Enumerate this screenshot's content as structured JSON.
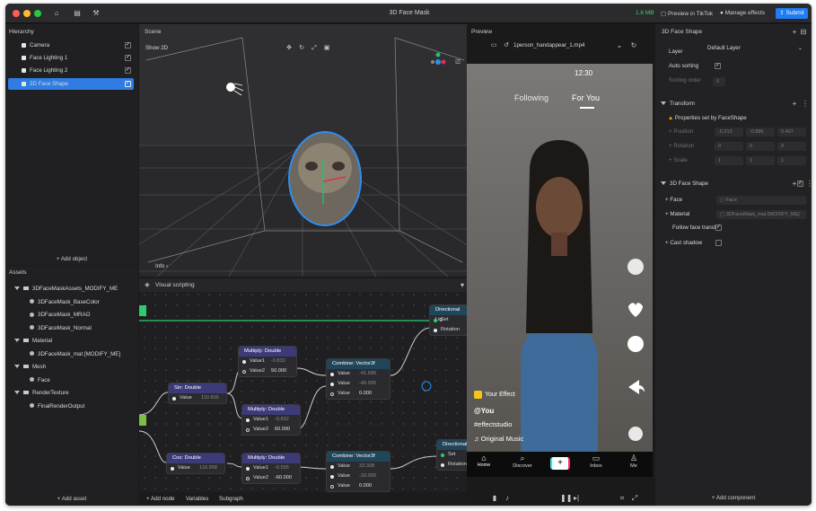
{
  "window": {
    "title": "3D Face Mask",
    "memory": "1.6 MB",
    "preview_in_tiktok": "Preview in TikTok",
    "manage_effects": "Manage effects",
    "submit": "Submit"
  },
  "hierarchy": {
    "title": "Hierarchy",
    "items": [
      {
        "label": "Camera"
      },
      {
        "label": "Face Lighting 1"
      },
      {
        "label": "Face Lighting 2"
      },
      {
        "label": "3D Face Shape"
      }
    ],
    "add_label": "+ Add object"
  },
  "assets": {
    "title": "Assets",
    "items": [
      {
        "label": "3DFaceMaskAssets_MODIFY_ME",
        "kind": "folder",
        "level": 0
      },
      {
        "label": "3DFaceMask_BaseColor",
        "kind": "file",
        "level": 1
      },
      {
        "label": "3DFaceMask_MRAO",
        "kind": "file",
        "level": 1
      },
      {
        "label": "3DFaceMask_Normal",
        "kind": "file",
        "level": 1
      },
      {
        "label": "Material",
        "kind": "folder",
        "level": 0
      },
      {
        "label": "3DFaceMask_mat [MODIFY_ME]",
        "kind": "file",
        "level": 1
      },
      {
        "label": "Mesh",
        "kind": "folder",
        "level": 0
      },
      {
        "label": "Face",
        "kind": "file",
        "level": 1
      },
      {
        "label": "RenderTexture",
        "kind": "folder",
        "level": 0
      },
      {
        "label": "FinalRenderOutput",
        "kind": "file",
        "level": 1
      }
    ],
    "add_label": "+ Add asset"
  },
  "scene": {
    "title": "Scene",
    "show2d": "Show 2D",
    "info": "Info"
  },
  "visual_scripting": {
    "title": "Visual scripting",
    "footer": {
      "add_node": "+ Add node",
      "variables": "Variables",
      "subgraph": "Subgraph"
    },
    "nodes": {
      "sin": {
        "title": "Sin: Double",
        "value_label": "Value",
        "value": "110.835"
      },
      "cos": {
        "title": "Cos: Double",
        "value_label": "Value",
        "value": "110.958"
      },
      "mul1": {
        "title": "Multiply: Double",
        "v1_label": "Value1",
        "v1": "-0.832",
        "v2_label": "Value2",
        "v2": "50.000"
      },
      "mul2": {
        "title": "Multiply: Double",
        "v1_label": "Value1",
        "v1": "-0.832",
        "v2_label": "Value2",
        "v2": "60.000"
      },
      "mul3": {
        "title": "Multiply: Double",
        "v1_label": "Value1",
        "v1": "-0.555",
        "v2_label": "Value2",
        "v2": "-60.000"
      },
      "comb1": {
        "title": "Combine: Vector3f",
        "r1_label": "Value",
        "r1": "-41.588",
        "r2_label": "Value",
        "r2": "-49.905",
        "r3_label": "Value",
        "r3": "0.000"
      },
      "comb2": {
        "title": "Combine: Vector3f",
        "r1_label": "Value",
        "r1": "33.308",
        "r2_label": "Value",
        "r2": "-33.000",
        "r3_label": "Value",
        "r3": "0.000"
      },
      "dir1": {
        "title": "Directional Lig",
        "set": "Set",
        "rotation": "Rotation"
      },
      "dir2": {
        "title": "Directional",
        "set": "Set",
        "rotation": "Rotation"
      }
    }
  },
  "preview": {
    "title": "Preview",
    "video": "1person_handappear_1.mp4",
    "time": "12:30",
    "tabs": {
      "following": "Following",
      "for_you": "For You"
    },
    "your_effect": "Your Effect",
    "user": "@You",
    "hashtag": "#effectstudio",
    "music": "Original Music",
    "nav": {
      "home": "Home",
      "discover": "Discover",
      "inbox": "Inbox",
      "me": "Me"
    }
  },
  "properties": {
    "title": "3D Face Shape",
    "layer_label": "Layer",
    "layer_value": "Default Layer",
    "auto_sorting": "Auto sorting",
    "sorting_order": "Sorting order",
    "sorting_value": "0",
    "transform": {
      "title": "Transform",
      "note": "Properties set by FaceShape",
      "position_label": "Position",
      "position": [
        "-0.313",
        "-0.886",
        "0.497"
      ],
      "rotation_label": "Rotation",
      "rotation": [
        "0",
        "0",
        "0"
      ],
      "scale_label": "Scale",
      "scale": [
        "1",
        "1",
        "1"
      ]
    },
    "face_shape": {
      "title": "3D Face Shape",
      "face_label": "Face",
      "face_value": "Face",
      "material_label": "Material",
      "material_value": "3DFaceMask_mat [MODIFY_ME]",
      "follow_label": "Follow face transf",
      "cast_shadow": "Cast shadow"
    },
    "add_component": "+ Add component"
  }
}
